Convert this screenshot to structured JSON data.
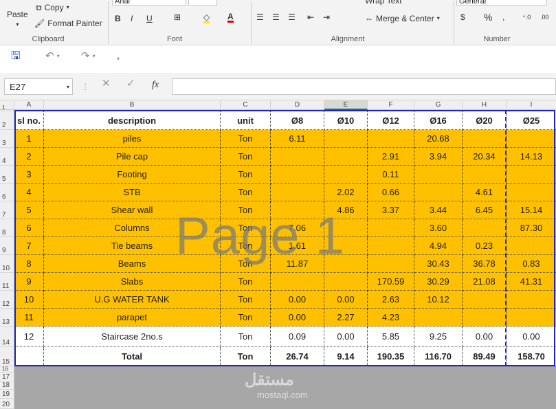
{
  "ribbon": {
    "clipboard": {
      "paste": "Paste",
      "copy": "Copy",
      "format_painter": "Format Painter",
      "label": "Clipboard"
    },
    "font": {
      "name": "Arial",
      "label": "Font"
    },
    "alignment": {
      "wrap_text": "Wrap Text",
      "merge_center": "Merge & Center",
      "label": "Alignment"
    },
    "number": {
      "format": "General",
      "label": "Number"
    }
  },
  "formula_bar": {
    "name_box": "E27",
    "fx": "fx",
    "value": ""
  },
  "columns": [
    "A",
    "B",
    "C",
    "D",
    "E",
    "F",
    "G",
    "H",
    "I"
  ],
  "row_numbers": [
    "1",
    "2",
    "3",
    "4",
    "5",
    "6",
    "7",
    "8",
    "9",
    "10",
    "11",
    "12",
    "13",
    "14",
    "15",
    "16",
    "17",
    "18",
    "19",
    "20"
  ],
  "table": {
    "headers": [
      "sl no.",
      "description",
      "unit",
      "Ø8",
      "Ø10",
      "Ø12",
      "Ø16",
      "Ø20",
      "Ø25"
    ],
    "rows": [
      [
        "1",
        "piles",
        "Ton",
        "6.11",
        "",
        "",
        "20.68",
        "",
        ""
      ],
      [
        "2",
        "Pile cap",
        "Ton",
        "",
        "",
        "2.91",
        "3.94",
        "20.34",
        "14.13"
      ],
      [
        "3",
        "Footing",
        "Ton",
        "",
        "",
        "0.11",
        "",
        "",
        ""
      ],
      [
        "4",
        "STB",
        "Ton",
        "",
        "2.02",
        "0.66",
        "",
        "4.61",
        ""
      ],
      [
        "5",
        "Shear wall",
        "Ton",
        "",
        "4.86",
        "3.37",
        "3.44",
        "6.45",
        "15.14"
      ],
      [
        "6",
        "Columns",
        "Ton",
        "7.06",
        "",
        "",
        "3.60",
        "",
        "87.30"
      ],
      [
        "7",
        "Tie beams",
        "Ton",
        "1.61",
        "",
        "",
        "4.94",
        "0.23",
        ""
      ],
      [
        "8",
        "Beams",
        "Ton",
        "11.87",
        "",
        "",
        "30.43",
        "36.78",
        "0.83"
      ],
      [
        "9",
        "Slabs",
        "Ton",
        "",
        "",
        "170.59",
        "30.29",
        "21.08",
        "41.31"
      ],
      [
        "10",
        "U.G WATER TANK",
        "Ton",
        "0.00",
        "0.00",
        "2.63",
        "10.12",
        "",
        ""
      ],
      [
        "11",
        "parapet",
        "Ton",
        "0.00",
        "2.27",
        "4.23",
        "",
        "",
        ""
      ],
      [
        "12",
        "Staircase 2no.s",
        "Ton",
        "0.09",
        "0.00",
        "5.85",
        "9.25",
        "0.00",
        "0.00"
      ]
    ],
    "total": [
      "",
      "Total",
      "Ton",
      "26.74",
      "9.14",
      "190.35",
      "116.70",
      "89.49",
      "158.70"
    ]
  },
  "watermark": "Page 1",
  "site_mark": {
    "arabic": "مستقل",
    "latin": "mostaql.com"
  },
  "colors": {
    "highlight": "#ffc000",
    "border": "#1f26b8"
  }
}
